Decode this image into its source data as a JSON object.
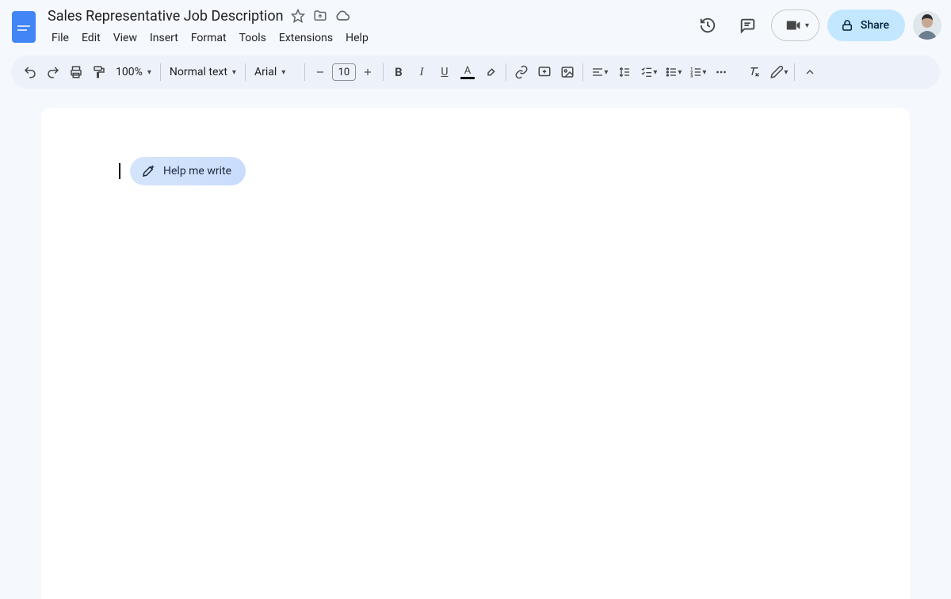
{
  "document": {
    "title": "Sales Representative Job Description"
  },
  "menus": [
    {
      "label": "File"
    },
    {
      "label": "Edit"
    },
    {
      "label": "View"
    },
    {
      "label": "Insert"
    },
    {
      "label": "Format"
    },
    {
      "label": "Tools"
    },
    {
      "label": "Extensions"
    },
    {
      "label": "Help"
    }
  ],
  "toolbar": {
    "zoom": "100%",
    "style": "Normal text",
    "font": "Arial",
    "font_size": "10"
  },
  "share": {
    "label": "Share"
  },
  "ai": {
    "help_write": "Help me write"
  }
}
